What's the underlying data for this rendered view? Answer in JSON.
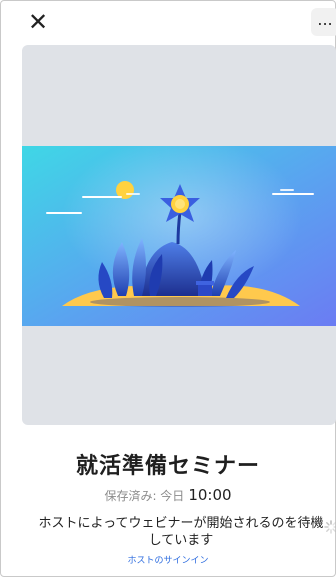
{
  "header": {
    "close_icon": "close-icon",
    "more_icon": "more-icon",
    "more_glyph": "..."
  },
  "webinar": {
    "title": "就活準備セミナー",
    "saved_label": "保存済み: 今日",
    "saved_time": "10:00",
    "waiting_message": "ホストによってウェビナーが開始されるのを待機しています",
    "host_signin": "ホストのサインイン"
  },
  "colors": {
    "accent": "#2d6cdf",
    "card_bg": "#dfe2e7"
  }
}
